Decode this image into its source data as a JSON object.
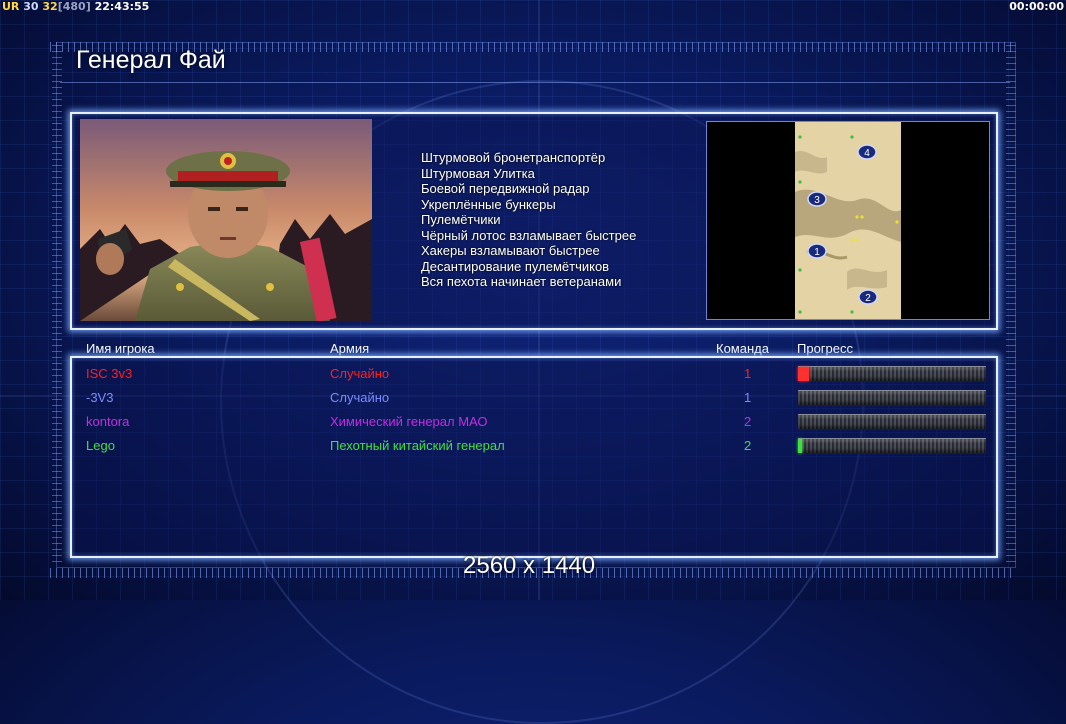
{
  "status": {
    "ur": "UR",
    "v1": "30",
    "v2": "32",
    "v3": "[480]",
    "clock": "22:43:55",
    "timer": "00:00:00"
  },
  "title": "Генерал Фай",
  "general_bonuses": [
    "Штурмовой бронетранспортёр",
    "Штурмовая Улитка",
    "Боевой передвижной радар",
    "Укреплённые бункеры",
    "Пулемётчики",
    "Чёрный лотос взламывает быстрее",
    "Хакеры взламывают быстрее",
    "Десантирование пулемётчиков",
    "Вся пехота начинает ветеранами"
  ],
  "minimap": {
    "start_positions": [
      "4",
      "3",
      "1",
      "2"
    ]
  },
  "table": {
    "headers": {
      "name": "Имя игрока",
      "army": "Армия",
      "team": "Команда",
      "progress": "Прогресс"
    },
    "players": [
      {
        "name": "ISC 3v3",
        "army": "Случайно",
        "team": "1",
        "color": "#ff2020",
        "progress": 0.06,
        "fill_color": "#ff3030"
      },
      {
        "name": "-3V3",
        "army": "Случайно",
        "team": "1",
        "color": "#7a8cff",
        "progress": 0.0,
        "fill_color": "#7a8cff"
      },
      {
        "name": "kontora",
        "army": "Химический генерал МАО",
        "team": "2",
        "color": "#c030e0",
        "progress": 0.0,
        "fill_color": "#c030e0"
      },
      {
        "name": "Lego",
        "army": "Пехотный китайский генерал",
        "team": "2",
        "color": "#40e040",
        "progress": 0.02,
        "fill_color": "#40e040"
      }
    ]
  },
  "resolution_text": "2560 x 1440"
}
